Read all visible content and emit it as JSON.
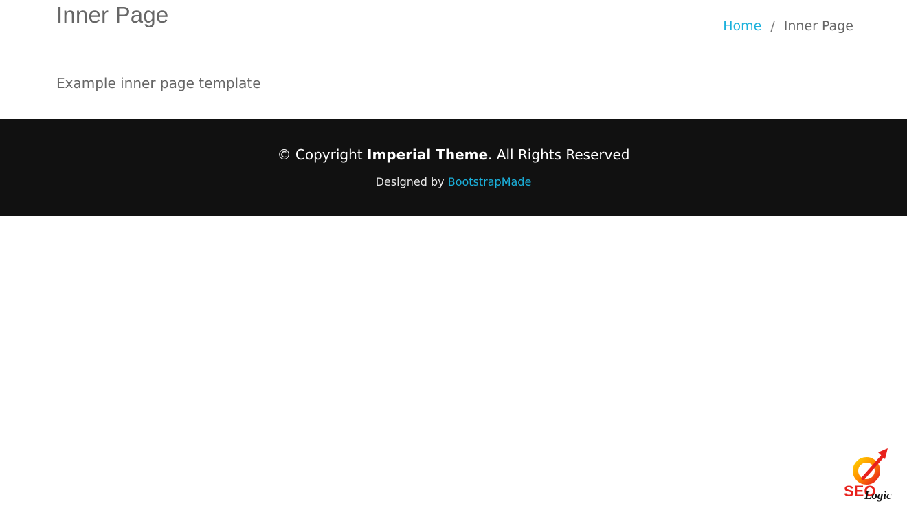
{
  "header": {
    "title": "Inner Page",
    "breadcrumb": {
      "home": "Home",
      "separator": "/",
      "current": "Inner Page"
    }
  },
  "main": {
    "intro": "Example inner page template"
  },
  "footer": {
    "copyright_prefix": "© Copyright ",
    "copyright_brand": "Imperial Theme",
    "copyright_suffix": ". All Rights Reserved",
    "designed_by": "Designed by ",
    "designer_link": "BootstrapMade"
  },
  "watermark": {
    "text_primary": "SEO",
    "text_secondary": "Logic"
  },
  "colors": {
    "link": "#1bb1dc",
    "footer_bg": "#111111",
    "text_muted": "#666666"
  }
}
